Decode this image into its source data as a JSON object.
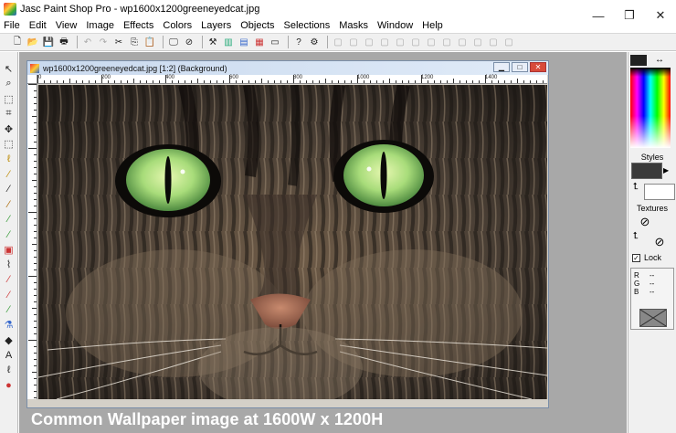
{
  "window": {
    "title": "Jasc Paint Shop Pro - wp1600x1200greeneyedcat.jpg",
    "controls": {
      "minimize": "—",
      "restore": "❐",
      "close": "✕"
    }
  },
  "menu": [
    "File",
    "Edit",
    "View",
    "Image",
    "Effects",
    "Colors",
    "Layers",
    "Objects",
    "Selections",
    "Masks",
    "Window",
    "Help"
  ],
  "toolbar_icons": [
    "new-icon",
    "open-icon",
    "save-icon",
    "print-icon",
    "|",
    "undo-icon",
    "redo-icon",
    "cut-icon",
    "copy-icon",
    "paste-icon",
    "|",
    "full-screen-icon",
    "browse-icon",
    "|",
    "tool-palette-icon",
    "histogram-icon",
    "layer-palette-icon",
    "overview-icon",
    "control-palette-icon",
    "|",
    "help-icon",
    "script-icon",
    "|",
    "toolbar-disabled-1",
    "toolbar-disabled-2",
    "toolbar-disabled-3",
    "toolbar-disabled-4",
    "toolbar-disabled-5",
    "toolbar-disabled-6",
    "toolbar-disabled-7",
    "toolbar-disabled-8",
    "toolbar-disabled-9",
    "toolbar-disabled-10",
    "toolbar-disabled-11",
    "toolbar-disabled-12"
  ],
  "tools": [
    "arrow-tool-icon",
    "zoom-tool-icon",
    "deform-tool-icon",
    "crop-tool-icon",
    "mover-tool-icon",
    "selection-tool-icon",
    "freehand-tool-icon",
    "magic-wand-tool-icon",
    "dropper-tool-icon",
    "paint-brush-tool-icon",
    "clone-brush-tool-icon",
    "color-replacer-tool-icon",
    "retouch-tool-icon",
    "scratch-remover-tool-icon",
    "eraser-tool-icon",
    "picture-tube-tool-icon",
    "airbrush-tool-icon",
    "flood-fill-tool-icon",
    "text-tool-icon",
    "draw-tool-icon",
    "preset-shapes-tool-icon",
    "object-selector-tool-icon"
  ],
  "document": {
    "title": "wp1600x1200greeneyedcat.jpg [1:2] (Background)",
    "ruler_labels": [
      "0",
      "200",
      "400",
      "600",
      "800",
      "1000",
      "1200",
      "1400"
    ],
    "controls": {
      "minimize": "▁",
      "maximize": "□",
      "close": "✕"
    }
  },
  "caption": "Common Wallpaper image at 1600W x 1200H",
  "palette": {
    "swap_arrow": "↔",
    "styles_label": "Styles",
    "textures_label": "Textures",
    "lock_label": "Lock",
    "lock_checked": true,
    "rgb": [
      {
        "label": "R",
        "value": "--"
      },
      {
        "label": "G",
        "value": "--"
      },
      {
        "label": "B",
        "value": "--"
      }
    ],
    "colors": {
      "foreground": "#222222",
      "background": "#ffffff"
    }
  }
}
